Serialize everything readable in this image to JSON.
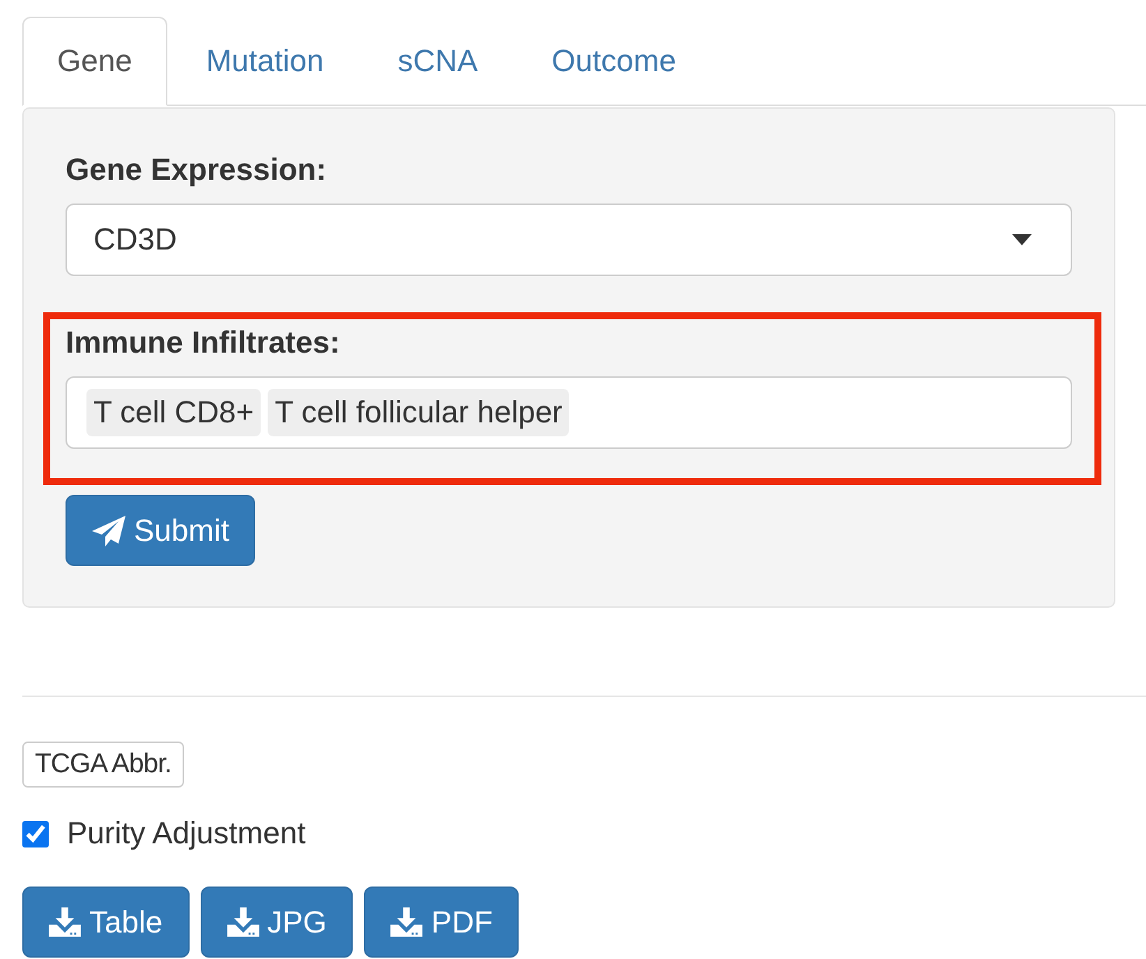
{
  "tabs": [
    {
      "label": "Gene",
      "selected": true
    },
    {
      "label": "Mutation",
      "selected": false
    },
    {
      "label": "sCNA",
      "selected": false
    },
    {
      "label": "Outcome",
      "selected": false
    }
  ],
  "panel": {
    "gene_expression": {
      "label": "Gene Expression:",
      "value": "CD3D"
    },
    "immune_infiltrates": {
      "label": "Immune Infiltrates:",
      "tags": [
        "T cell CD8+",
        "T cell follicular helper"
      ],
      "highlighted": true
    },
    "submit_button": {
      "label": "Submit"
    }
  },
  "abbr_button": {
    "label": "TCGA Abbr."
  },
  "purity_adjustment": {
    "label": "Purity Adjustment",
    "checked": true
  },
  "download_buttons": [
    {
      "label": "Table"
    },
    {
      "label": "JPG"
    },
    {
      "label": "PDF"
    }
  ]
}
